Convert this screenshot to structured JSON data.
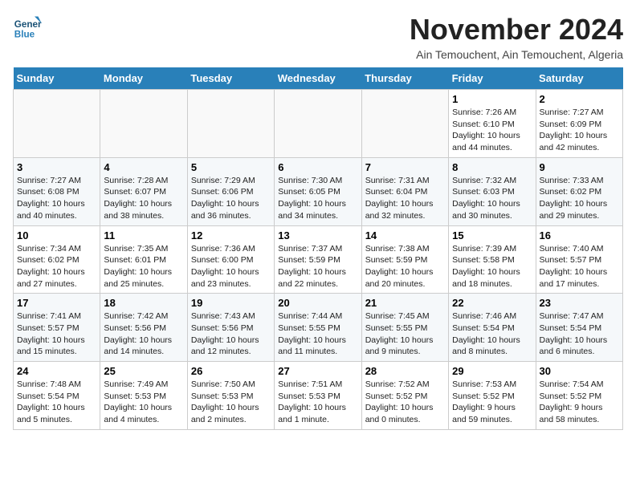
{
  "header": {
    "logo_text_general": "General",
    "logo_text_blue": "Blue",
    "month": "November 2024",
    "location": "Ain Temouchent, Ain Temouchent, Algeria"
  },
  "calendar": {
    "weekdays": [
      "Sunday",
      "Monday",
      "Tuesday",
      "Wednesday",
      "Thursday",
      "Friday",
      "Saturday"
    ],
    "weeks": [
      [
        {
          "day": "",
          "info": ""
        },
        {
          "day": "",
          "info": ""
        },
        {
          "day": "",
          "info": ""
        },
        {
          "day": "",
          "info": ""
        },
        {
          "day": "",
          "info": ""
        },
        {
          "day": "1",
          "info": "Sunrise: 7:26 AM\nSunset: 6:10 PM\nDaylight: 10 hours\nand 44 minutes."
        },
        {
          "day": "2",
          "info": "Sunrise: 7:27 AM\nSunset: 6:09 PM\nDaylight: 10 hours\nand 42 minutes."
        }
      ],
      [
        {
          "day": "3",
          "info": "Sunrise: 7:27 AM\nSunset: 6:08 PM\nDaylight: 10 hours\nand 40 minutes."
        },
        {
          "day": "4",
          "info": "Sunrise: 7:28 AM\nSunset: 6:07 PM\nDaylight: 10 hours\nand 38 minutes."
        },
        {
          "day": "5",
          "info": "Sunrise: 7:29 AM\nSunset: 6:06 PM\nDaylight: 10 hours\nand 36 minutes."
        },
        {
          "day": "6",
          "info": "Sunrise: 7:30 AM\nSunset: 6:05 PM\nDaylight: 10 hours\nand 34 minutes."
        },
        {
          "day": "7",
          "info": "Sunrise: 7:31 AM\nSunset: 6:04 PM\nDaylight: 10 hours\nand 32 minutes."
        },
        {
          "day": "8",
          "info": "Sunrise: 7:32 AM\nSunset: 6:03 PM\nDaylight: 10 hours\nand 30 minutes."
        },
        {
          "day": "9",
          "info": "Sunrise: 7:33 AM\nSunset: 6:02 PM\nDaylight: 10 hours\nand 29 minutes."
        }
      ],
      [
        {
          "day": "10",
          "info": "Sunrise: 7:34 AM\nSunset: 6:02 PM\nDaylight: 10 hours\nand 27 minutes."
        },
        {
          "day": "11",
          "info": "Sunrise: 7:35 AM\nSunset: 6:01 PM\nDaylight: 10 hours\nand 25 minutes."
        },
        {
          "day": "12",
          "info": "Sunrise: 7:36 AM\nSunset: 6:00 PM\nDaylight: 10 hours\nand 23 minutes."
        },
        {
          "day": "13",
          "info": "Sunrise: 7:37 AM\nSunset: 5:59 PM\nDaylight: 10 hours\nand 22 minutes."
        },
        {
          "day": "14",
          "info": "Sunrise: 7:38 AM\nSunset: 5:59 PM\nDaylight: 10 hours\nand 20 minutes."
        },
        {
          "day": "15",
          "info": "Sunrise: 7:39 AM\nSunset: 5:58 PM\nDaylight: 10 hours\nand 18 minutes."
        },
        {
          "day": "16",
          "info": "Sunrise: 7:40 AM\nSunset: 5:57 PM\nDaylight: 10 hours\nand 17 minutes."
        }
      ],
      [
        {
          "day": "17",
          "info": "Sunrise: 7:41 AM\nSunset: 5:57 PM\nDaylight: 10 hours\nand 15 minutes."
        },
        {
          "day": "18",
          "info": "Sunrise: 7:42 AM\nSunset: 5:56 PM\nDaylight: 10 hours\nand 14 minutes."
        },
        {
          "day": "19",
          "info": "Sunrise: 7:43 AM\nSunset: 5:56 PM\nDaylight: 10 hours\nand 12 minutes."
        },
        {
          "day": "20",
          "info": "Sunrise: 7:44 AM\nSunset: 5:55 PM\nDaylight: 10 hours\nand 11 minutes."
        },
        {
          "day": "21",
          "info": "Sunrise: 7:45 AM\nSunset: 5:55 PM\nDaylight: 10 hours\nand 9 minutes."
        },
        {
          "day": "22",
          "info": "Sunrise: 7:46 AM\nSunset: 5:54 PM\nDaylight: 10 hours\nand 8 minutes."
        },
        {
          "day": "23",
          "info": "Sunrise: 7:47 AM\nSunset: 5:54 PM\nDaylight: 10 hours\nand 6 minutes."
        }
      ],
      [
        {
          "day": "24",
          "info": "Sunrise: 7:48 AM\nSunset: 5:54 PM\nDaylight: 10 hours\nand 5 minutes."
        },
        {
          "day": "25",
          "info": "Sunrise: 7:49 AM\nSunset: 5:53 PM\nDaylight: 10 hours\nand 4 minutes."
        },
        {
          "day": "26",
          "info": "Sunrise: 7:50 AM\nSunset: 5:53 PM\nDaylight: 10 hours\nand 2 minutes."
        },
        {
          "day": "27",
          "info": "Sunrise: 7:51 AM\nSunset: 5:53 PM\nDaylight: 10 hours\nand 1 minute."
        },
        {
          "day": "28",
          "info": "Sunrise: 7:52 AM\nSunset: 5:52 PM\nDaylight: 10 hours\nand 0 minutes."
        },
        {
          "day": "29",
          "info": "Sunrise: 7:53 AM\nSunset: 5:52 PM\nDaylight: 9 hours\nand 59 minutes."
        },
        {
          "day": "30",
          "info": "Sunrise: 7:54 AM\nSunset: 5:52 PM\nDaylight: 9 hours\nand 58 minutes."
        }
      ]
    ]
  }
}
